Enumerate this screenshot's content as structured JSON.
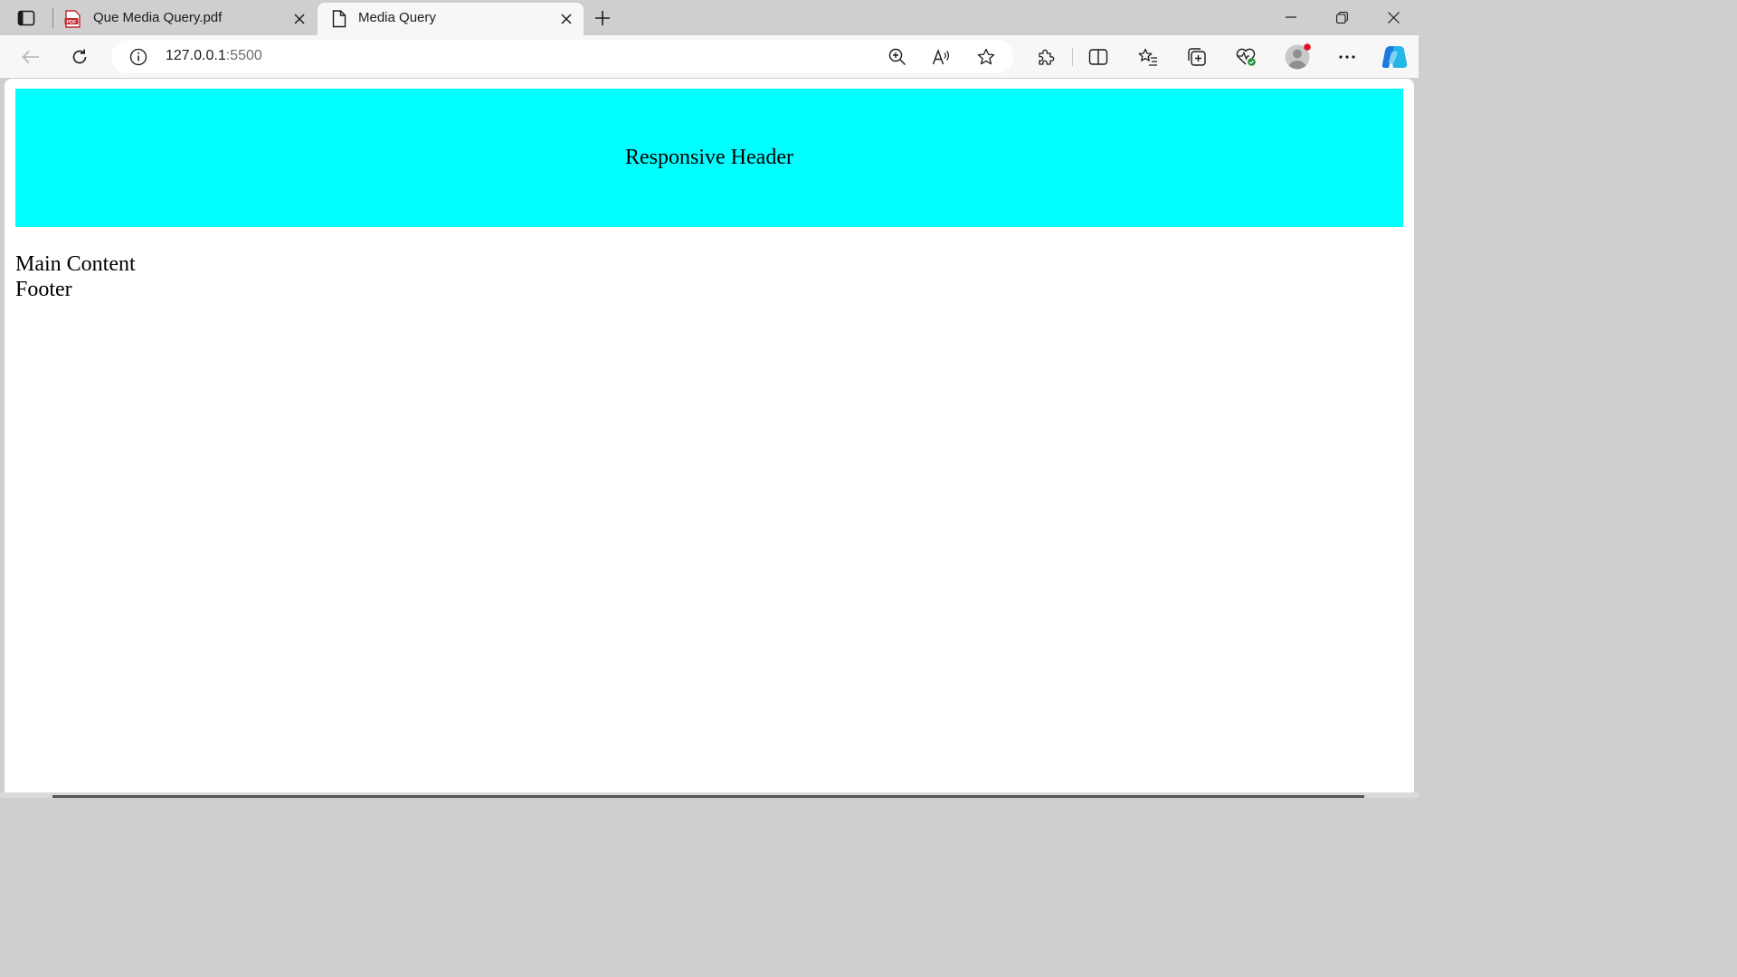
{
  "browser": {
    "tabs": [
      {
        "title": "Que Media Query.pdf",
        "icon": "pdf-icon",
        "active": false
      },
      {
        "title": "Media Query",
        "icon": "document-icon",
        "active": true
      }
    ],
    "address": {
      "host": "127.0.0.1",
      "port": ":5500"
    },
    "accent_colors": {
      "profile_dot": "#e81123",
      "copilot": "#1f7ae0"
    }
  },
  "page": {
    "header": "Responsive Header",
    "main": "Main Content",
    "footer": "Footer",
    "header_bg": "#00ffff"
  }
}
